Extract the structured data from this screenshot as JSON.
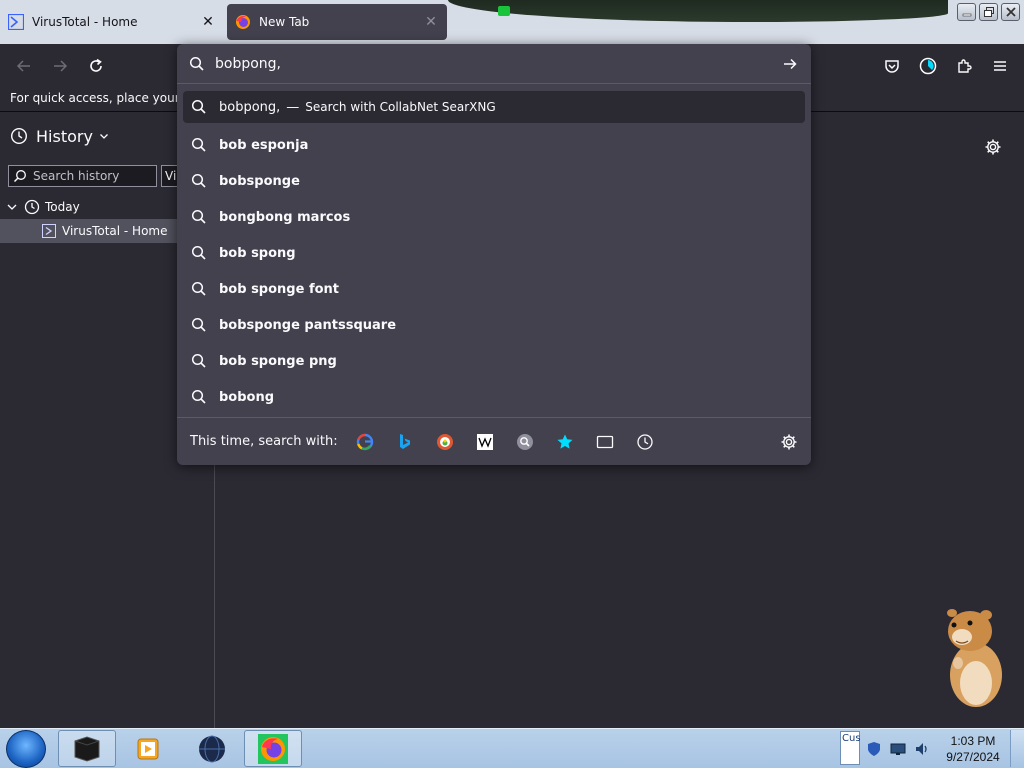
{
  "tabs": [
    {
      "label": "VirusTotal - Home",
      "icon": "virustotal-icon",
      "active": false
    },
    {
      "label": "New Tab",
      "icon": "firefox-icon",
      "active": true
    }
  ],
  "urlbar": {
    "value": "bobpong,",
    "heuristic": {
      "query": "bobpong,",
      "separator": "—",
      "action": "Search with CollabNet SearXNG"
    },
    "suggestions": [
      "bob esponja",
      "bobsponge",
      "bongbong marcos",
      "bob spong",
      "bob sponge font",
      "bobsponge pantssquare",
      "bob sponge png",
      "bobong"
    ],
    "oneoff_label": "This time, search with:",
    "engines": [
      "google-icon",
      "bing-icon",
      "duckduckgo-icon",
      "wikipedia-icon",
      "searxng-icon",
      "bookmarks-icon",
      "tabs-icon",
      "history-icon"
    ]
  },
  "bookmarks_bar": {
    "hint": "For quick access, place your boo"
  },
  "sidebar": {
    "title": "History",
    "search_placeholder": "Search history",
    "view_label": "Vi",
    "group": "Today",
    "entries": [
      "VirusTotal - Home"
    ]
  },
  "taskbar": {
    "lang": "Cus",
    "time": "1:03 PM",
    "date": "9/27/2024"
  },
  "colors": {
    "accent": "#00ddff",
    "toolbar": "#2b2a33",
    "panel": "#42414d"
  }
}
